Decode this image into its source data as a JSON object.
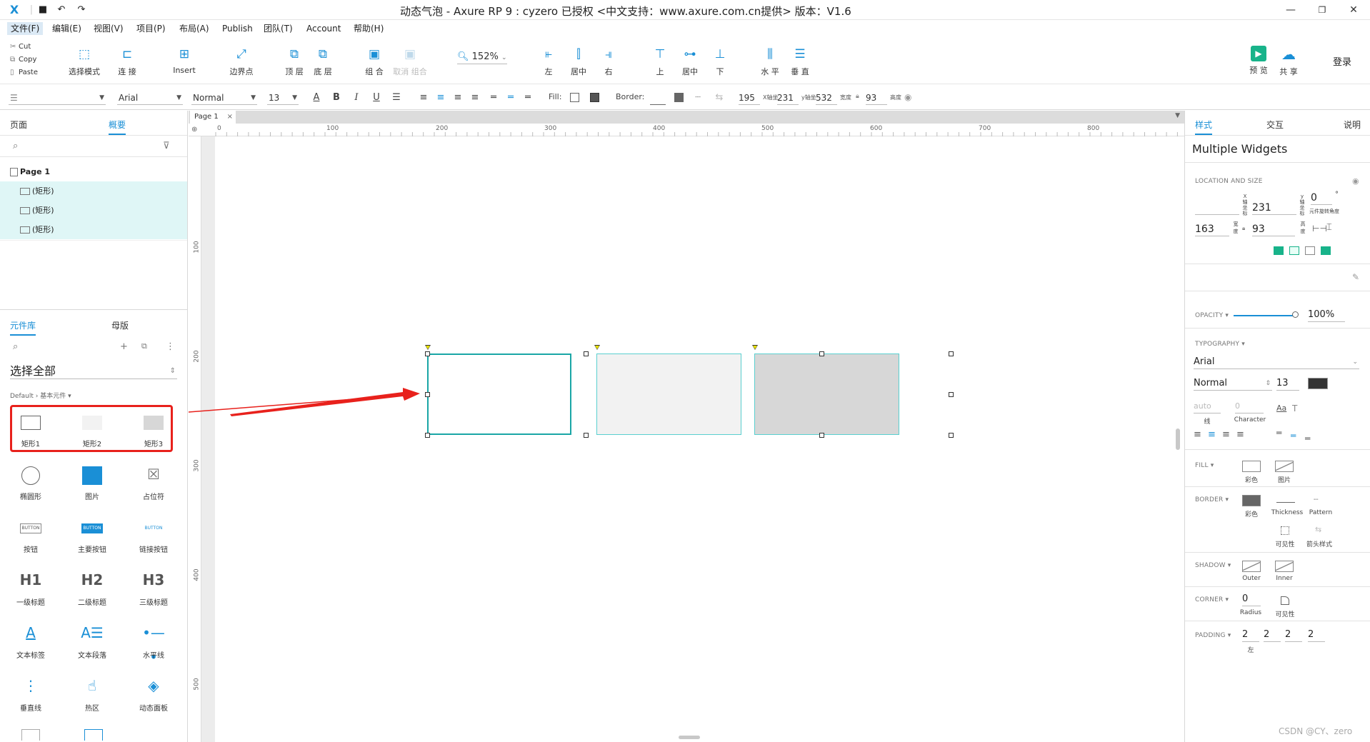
{
  "window": {
    "title": "动态气泡 - Axure RP 9 : cyzero 已授权    <中文支持：www.axure.com.cn提供> 版本：V1.6",
    "logo": "X"
  },
  "menu": [
    "文件(F)",
    "编辑(E)",
    "视图(V)",
    "项目(P)",
    "布局(A)",
    "Publish",
    "团队(T)",
    "Account",
    "帮助(H)"
  ],
  "toolbar": {
    "clipboard": [
      "Cut",
      "Copy",
      "Paste"
    ],
    "tools": [
      "选择模式",
      "连 接",
      "Insert",
      "边界点",
      "顶 层",
      "底 层",
      "组 合",
      "取消 组合",
      "左",
      "居中",
      "右",
      "上",
      "居中",
      "下",
      "水 平",
      "垂 直"
    ],
    "zoom": "152%",
    "preview": "预 览",
    "share": "共 享",
    "login": "登录"
  },
  "format": {
    "font": "Arial",
    "style": "Normal",
    "size": "13",
    "fill_label": "Fill:",
    "border_label": "Border:",
    "x": "195",
    "x_label": "X轴坐",
    "y": "231",
    "y_label": "y轴坐",
    "w": "532",
    "w_label": "宽度",
    "h": "93",
    "h_label": "高度"
  },
  "left": {
    "tab_pages": "页面",
    "tab_outline": "概要",
    "page_name": "Page 1",
    "outline_items": [
      "(矩形)",
      "(矩形)",
      "(矩形)"
    ],
    "tab_library": "元件库",
    "tab_masters": "母版",
    "library_select": "选择全部",
    "library_path": "Default › 基本元件 ▾",
    "widgets": [
      "矩形1",
      "矩形2",
      "矩形3",
      "椭圆形",
      "图片",
      "占位符",
      "按钮",
      "主要按钮",
      "链接按钮",
      "一级标题",
      "二级标题",
      "三级标题",
      "文本标签",
      "文本段落",
      "水平线",
      "垂直线",
      "热区",
      "动态面板"
    ],
    "widget_button_text": "BUTTON"
  },
  "canvas": {
    "tab": "Page 1",
    "hruler": [
      "0",
      "100",
      "200",
      "300",
      "400",
      "500",
      "600",
      "700",
      "800"
    ],
    "vruler": [
      "100",
      "200",
      "300",
      "400",
      "500"
    ],
    "colors": {
      "teal": "#1aa6a6",
      "fill2": "#f2f2f2",
      "fill3": "#d7d7d7",
      "arrow": "#e8211c"
    }
  },
  "right": {
    "tab_style": "样式",
    "tab_interact": "交互",
    "tab_notes": "说明",
    "heading": "Multiple Widgets",
    "location": "LOCATION AND SIZE",
    "x_label": "X轴坐标",
    "x": "",
    "y_label": "y轴坐标",
    "y": "231",
    "rot_label": "元件旋转角度",
    "rot": "0",
    "rot_unit": "°",
    "w_label": "宽度",
    "w": "163",
    "h_label": "高度",
    "h": "93",
    "opacity_label": "OPACITY ▾",
    "opacity": "100%",
    "typography_label": "TYPOGRAPHY ▾",
    "font": "Arial",
    "font_style": "Normal",
    "font_size": "13",
    "line_val": "auto",
    "line_label": "线",
    "char_val": "0",
    "char_label": "Character",
    "fill_label": "FILL ▾",
    "fill_color": "彩色",
    "fill_image": "图片",
    "border_label": "BORDER ▾",
    "border_color": "彩色",
    "thickness": "Thickness",
    "pattern": "Pattern",
    "visibility": "可见性",
    "arrow_style": "箭头样式",
    "shadow_label": "SHADOW ▾",
    "outer": "Outer",
    "inner": "Inner",
    "corner_label": "CORNER ▾",
    "radius": "0",
    "radius_label": "Radius",
    "corner_vis": "可见性",
    "padding_label": "PADDING ▾",
    "padding": [
      "2",
      "2",
      "2",
      "2"
    ],
    "padding_left_label": "左"
  },
  "watermark": "CSDN @CY、zero"
}
